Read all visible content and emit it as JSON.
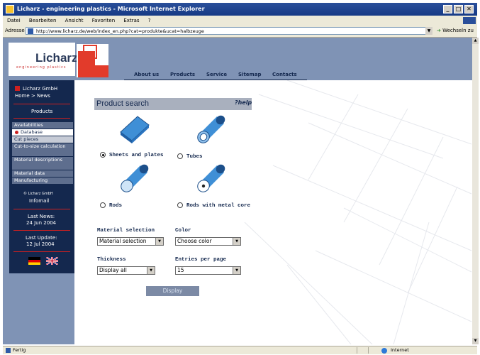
{
  "window": {
    "title": "Licharz - engineering plastics - Microsoft Internet Explorer"
  },
  "menu": [
    "Datei",
    "Bearbeiten",
    "Ansicht",
    "Favoriten",
    "Extras",
    "?"
  ],
  "address": {
    "label": "Adresse",
    "url": "http://www.licharz.de/web/index_en.php?cat=produkte&ucat=halbzeuge",
    "go": "Wechseln zu"
  },
  "brand": {
    "name": "Licharz",
    "tagline": "engineering plastics"
  },
  "topnav": [
    "About us",
    "Products",
    "Service",
    "Sitemap",
    "Contacts"
  ],
  "sidebar": {
    "company": "Licharz GmbH",
    "breadcrumb": "Home > News",
    "section": "Products",
    "items": [
      {
        "label": "Availabilities",
        "state": "dark"
      },
      {
        "label": "Database",
        "state": "active"
      },
      {
        "label": "Cut pieces",
        "state": "light"
      },
      {
        "label": "Cut-to-size calculation",
        "state": "dark"
      },
      {
        "label": "Material descriptions",
        "state": "dark"
      },
      {
        "label": "Material data",
        "state": "dark"
      },
      {
        "label": "Manufacturing",
        "state": "dark"
      }
    ],
    "infomail_small": "© Licharz GmbH",
    "infomail": "Infomail",
    "last_news_label": "Last News:",
    "last_news_date": "24 Jun 2004",
    "last_update_label": "Last Update:",
    "last_update_date": "12 Jul 2004"
  },
  "search": {
    "title": "Product search",
    "help": "?help",
    "options": [
      {
        "label": "Sheets and plates",
        "checked": true
      },
      {
        "label": "Tubes",
        "checked": false
      },
      {
        "label": "Rods",
        "checked": false
      },
      {
        "label": "Rods with metal core",
        "checked": false
      }
    ],
    "material_label": "Material selection",
    "material_value": "Material selection",
    "color_label": "Color",
    "color_value": "Choose color",
    "thickness_label": "Thickness",
    "thickness_value": "Display all",
    "entries_label": "Entries per page",
    "entries_value": "15",
    "button": "Display"
  },
  "status": {
    "left": "Fertig",
    "zone": "Internet"
  },
  "colors": {
    "navy": "#14284e",
    "frame": "#7f93b5",
    "red": "#cc2020",
    "product_blue": "#3f8fd6"
  }
}
